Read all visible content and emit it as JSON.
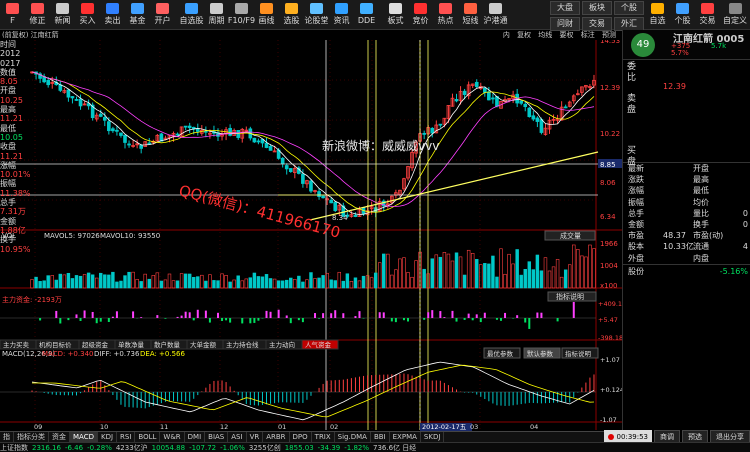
{
  "toolbar": {
    "items": [
      {
        "label": "Ｆ",
        "color": "#ff5050"
      },
      {
        "label": "修正",
        "color": "#ff5050"
      },
      {
        "label": "新闻",
        "color": "#ccc"
      },
      {
        "label": "买入",
        "color": "#ff3030"
      },
      {
        "label": "卖出",
        "color": "#3080ff"
      },
      {
        "label": "基金",
        "color": "#40a0ff"
      },
      {
        "label": "开户",
        "color": "#ff6060"
      },
      {
        "label": "自选股",
        "color": "#3aa0ff"
      },
      {
        "label": "周期",
        "color": "#ccc"
      },
      {
        "label": "F10/F9",
        "color": "#aaa"
      },
      {
        "label": "画线",
        "color": "#ff9020"
      },
      {
        "label": "选股",
        "color": "#ffb020"
      },
      {
        "label": "论股堂",
        "color": "#60c0ff"
      },
      {
        "label": "资讯",
        "color": "#30a0ff"
      },
      {
        "label": "DDE",
        "color": "#40b0ff"
      },
      {
        "label": "板式",
        "color": "#ddd"
      },
      {
        "label": "竞价",
        "color": "#ff3030"
      },
      {
        "label": "热点",
        "color": "#ff5050"
      },
      {
        "label": "短线",
        "color": "#ff6040"
      },
      {
        "label": "沪港通",
        "color": "#ccc"
      }
    ],
    "nav": [
      [
        "大盘",
        "板块",
        "个股"
      ],
      [
        "问财",
        "交易",
        "外汇"
      ]
    ],
    "right": [
      "自选",
      "个股",
      "交易",
      "自定义"
    ]
  },
  "chart_title": {
    "left": "(前复权) 江南红箭",
    "right": [
      "内",
      "复权",
      "均线",
      "要权",
      "标注",
      "预测"
    ]
  },
  "left_panel": [
    {
      "label": "时间",
      "value": "2012",
      "value2": "0217",
      "class": "lbl"
    },
    {
      "label": "数值",
      "value": "8.05",
      "vclass": "vred"
    },
    {
      "label": "开盘",
      "value": "10.25",
      "vclass": "vred"
    },
    {
      "label": "最高",
      "value": "11.21",
      "vclass": "vred"
    },
    {
      "label": "最低",
      "value": "10.05",
      "vclass": "vgrn"
    },
    {
      "label": "收盘",
      "value": "11.21",
      "vclass": "vred"
    },
    {
      "label": "涨幅",
      "value": "10.01%",
      "vclass": "vred"
    },
    {
      "label": "振幅",
      "value": "11.38%",
      "vclass": "vred"
    },
    {
      "label": "总手",
      "value": "7.31万",
      "vclass": "vred"
    },
    {
      "label": "金额",
      "value": "1.88亿",
      "vclass": "vred"
    },
    {
      "label": "换手",
      "value": "10.95%",
      "vclass": "vred"
    }
  ],
  "price_axis": [
    "14.53",
    "12.39",
    "10.22",
    "8.85",
    "8.06",
    "6.34"
  ],
  "ma_legend": {
    "mavol5": "MAVOL5: 97026",
    "mavol10": "MAVOL10: 93550",
    "button": "成交量"
  },
  "vol_axis": [
    "1966",
    "1004",
    "x100"
  ],
  "fund_legend": {
    "label": "主力资金:",
    "value": "-2193万",
    "button": "指标说明",
    "axis": [
      "+409.12",
      "+5.47",
      "-398.18"
    ]
  },
  "fund_tabs": [
    "主力买卖",
    "机构目标价",
    "超级资金",
    "单数净量",
    "散户数量",
    "大单金额",
    "主力持仓线",
    "主力动向",
    "人气资金"
  ],
  "macd": {
    "label": "MACD(12,26,9)",
    "macd_val": "MACD: +0.340",
    "diff": "DIFF: +0.736",
    "dea": "DEA: +0.566",
    "buttons": [
      "最优参数",
      "默认参数",
      "指标说明"
    ],
    "axis": [
      "+1.07",
      "+0.124",
      "-1.07"
    ]
  },
  "date_axis": [
    "09",
    "10",
    "11",
    "12",
    "01",
    "02",
    "2012-02-17五",
    "03",
    "04"
  ],
  "watermark": {
    "weibo": "新浪微博：威威威vvv",
    "qq": "QQ(微信)：411966170"
  },
  "annot": "8.34",
  "right_panel": {
    "circle": "49",
    "name": "江南红箭",
    "code": "0005",
    "rowA": "+375",
    "rowB": "5.7%",
    "rowC": "5.7k",
    "side_labels": [
      "委比",
      "卖",
      "盘",
      "买",
      "盘"
    ],
    "quote": [
      [
        "最新",
        "",
        "开盘",
        ""
      ],
      [
        "涨跌",
        "",
        "最高",
        ""
      ],
      [
        "涨幅",
        "",
        "最低",
        ""
      ],
      [
        "振幅",
        "",
        "均价",
        ""
      ],
      [
        "总手",
        "",
        "量比",
        "0"
      ],
      [
        "金额",
        "",
        "换手",
        "0"
      ],
      [
        "市盈",
        "48.37",
        "市盈(动)",
        ""
      ],
      [
        "股本",
        "10.33亿",
        "流通",
        "4"
      ],
      [
        "外盘",
        "",
        "内盘",
        ""
      ]
    ],
    "bottom_label": "股份",
    "bottom_value": "-5.16%",
    "bottom_tabs": [
      "财务",
      "",
      "两行",
      "",
      "资讯",
      "",
      "两行业"
    ]
  },
  "indicator_tabs": [
    "指",
    "指标分类",
    "资金",
    "MACD",
    "KDJ",
    "RSI",
    "BOLL",
    "W&R",
    "DMI",
    "BIAS",
    "ASI",
    "VR",
    "ARBR",
    "DPO",
    "TRIX",
    "Sig.DMA",
    "BBI",
    "EXPMA",
    "SKDJ"
  ],
  "status": {
    "items": [
      {
        "text": "上证指数",
        "color": "#ccc"
      },
      {
        "text": "2316.16",
        "color": "#00e060"
      },
      {
        "text": "-6.46",
        "color": "#00e060"
      },
      {
        "text": "-0.28%",
        "color": "#00e060"
      },
      {
        "text": "4233亿沪",
        "color": "#ccc"
      },
      {
        "text": "10054.88",
        "color": "#00e060"
      },
      {
        "text": "-107.72",
        "color": "#00e060"
      },
      {
        "text": "-1.06%",
        "color": "#00e060"
      },
      {
        "text": "3255亿创",
        "color": "#ccc"
      },
      {
        "text": "1855.03",
        "color": "#00e060"
      },
      {
        "text": "-34.39",
        "color": "#00e060"
      },
      {
        "text": "-1.82%",
        "color": "#00e060"
      },
      {
        "text": "736.6亿 日经",
        "color": "#ccc"
      }
    ],
    "timer": "00:39:53",
    "buttons": [
      "商调",
      "预选",
      "退出分享"
    ]
  },
  "colors": {
    "up": "#ff4040",
    "down": "#00c8c8",
    "ma_white": "#ffffff",
    "ma_yellow": "#ffff00",
    "ma_magenta": "#ff40ff",
    "green": "#00e060"
  }
}
